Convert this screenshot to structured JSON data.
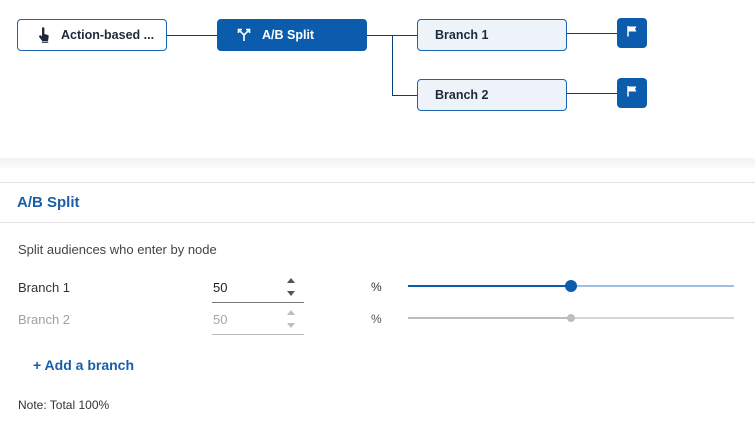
{
  "flow": {
    "trigger_node": {
      "label": "Action-based ...",
      "icon": "pointer-hand-icon"
    },
    "split_node": {
      "label": "A/B Split",
      "icon": "split-arrows-icon"
    },
    "branches": [
      {
        "label": "Branch 1"
      },
      {
        "label": "Branch 2"
      }
    ],
    "end_icon": "flag-icon"
  },
  "panel": {
    "title": "A/B Split",
    "description": "Split audiences who enter by node",
    "rows": [
      {
        "label": "Branch 1",
        "value": "50",
        "unit": "%",
        "slider_percent": 50,
        "disabled": false
      },
      {
        "label": "Branch 2",
        "value": "50",
        "unit": "%",
        "slider_percent": 50,
        "disabled": true
      }
    ],
    "add_branch_label": "+ Add a branch",
    "note": "Note: Total 100%"
  },
  "colors": {
    "primary": "#0b5cad",
    "branch_fill": "#eef3f9",
    "title_blue": "#1a5ea8",
    "disabled": "#bdbdbd"
  }
}
